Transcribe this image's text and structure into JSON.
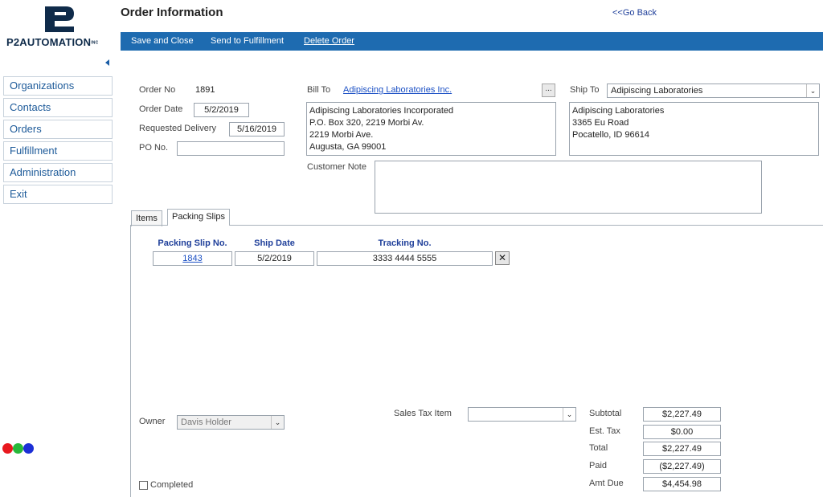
{
  "brand": {
    "name": "P2AUTOMATION",
    "reg": "INC"
  },
  "header": {
    "title": "Order Information",
    "go_back": "<<Go Back"
  },
  "toolbar": {
    "save_close": "Save and Close",
    "send_fulfillment": "Send to Fulfillment",
    "delete_order": "Delete Order"
  },
  "sidebar": {
    "items": [
      {
        "label": "Organizations"
      },
      {
        "label": "Contacts"
      },
      {
        "label": "Orders"
      },
      {
        "label": "Fulfillment"
      },
      {
        "label": "Administration"
      },
      {
        "label": "Exit"
      }
    ]
  },
  "order": {
    "order_no_label": "Order No",
    "order_no": "1891",
    "order_date_label": "Order Date",
    "order_date": "5/2/2019",
    "requested_label": "Requested Delivery",
    "requested": "5/16/2019",
    "po_label": "PO No.",
    "po": ""
  },
  "bill_to": {
    "label": "Bill To",
    "link": "Adipiscing Laboratories Inc.",
    "button": "...",
    "address": [
      "Adipiscing Laboratories Incorporated",
      "P.O. Box 320, 2219 Morbi Av.",
      "2219 Morbi Ave.",
      "Augusta, GA 99001"
    ]
  },
  "ship_to": {
    "label": "Ship To",
    "selected": "Adipiscing Laboratories",
    "address": [
      "Adipiscing Laboratories",
      "3365 Eu Road",
      "Pocatello, ID 96614"
    ]
  },
  "customer_note": {
    "label": "Customer Note",
    "value": ""
  },
  "tabs": [
    {
      "label": "Items"
    },
    {
      "label": "Packing Slips"
    }
  ],
  "packing_slips": {
    "headers": [
      "Packing Slip No.",
      "Ship Date",
      "Tracking No."
    ],
    "rows": [
      {
        "slip_no": "1843",
        "ship_date": "5/2/2019",
        "tracking": "3333 4444 5555"
      }
    ]
  },
  "footer": {
    "owner_label": "Owner",
    "owner": "Davis Holder",
    "sales_tax_label": "Sales Tax Item",
    "sales_tax": "",
    "completed_label": "Completed",
    "completed": false
  },
  "totals": [
    {
      "label": "Subtotal",
      "value": "$2,227.49"
    },
    {
      "label": "Est. Tax",
      "value": "$0.00"
    },
    {
      "label": "Total",
      "value": "$2,227.49"
    },
    {
      "label": "Paid",
      "value": "($2,227.49)"
    },
    {
      "label": "Amt Due",
      "value": "$4,454.98"
    }
  ],
  "colors": {
    "toolbar": "#1e6bb0",
    "nav_text": "#1d5a99",
    "dot_red": "#e8181e",
    "dot_green": "#28b83a",
    "dot_blue": "#1c2fd6"
  }
}
